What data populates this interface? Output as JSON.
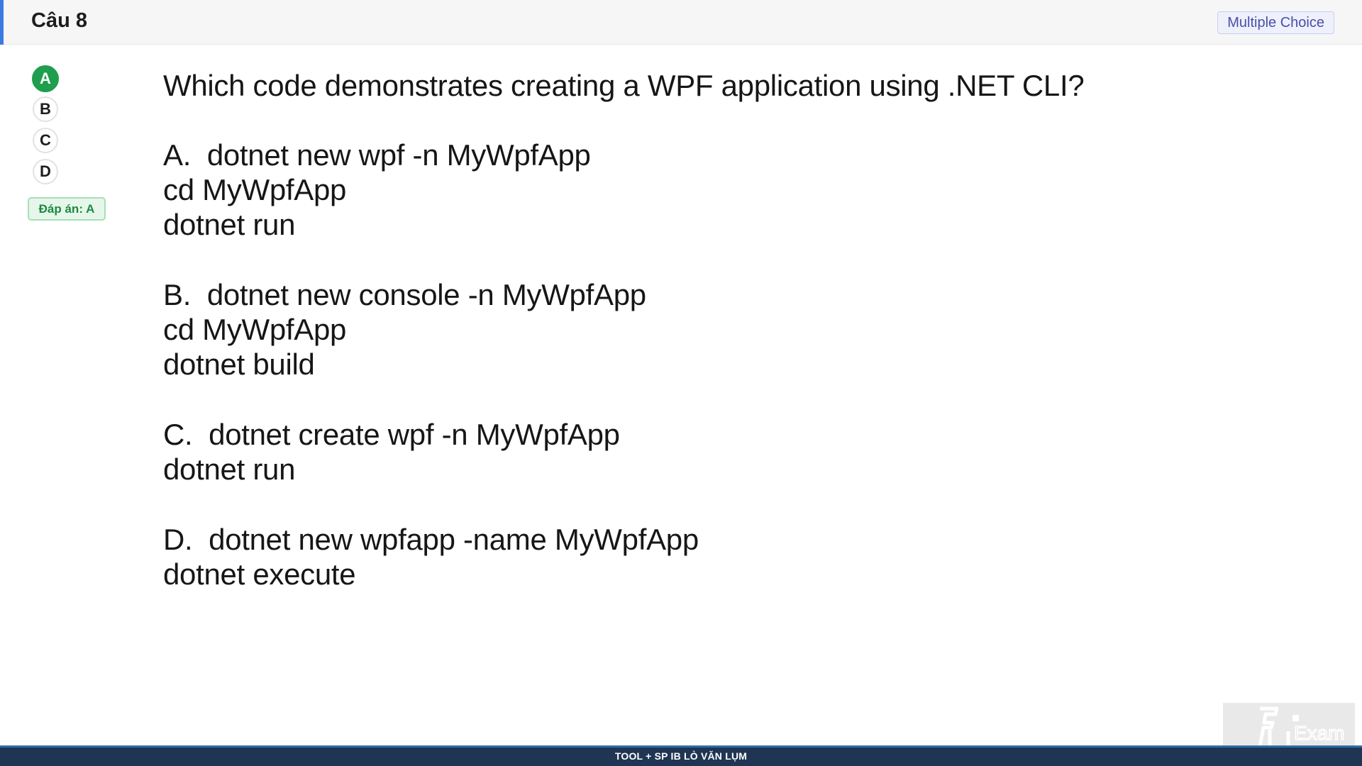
{
  "header": {
    "question_number": "Câu 8",
    "question_type": "Multiple Choice"
  },
  "options": [
    {
      "letter": "A",
      "correct": true
    },
    {
      "letter": "B",
      "correct": false
    },
    {
      "letter": "C",
      "correct": false
    },
    {
      "letter": "D",
      "correct": false
    }
  ],
  "answer_label": "Đáp án: A",
  "question": {
    "text": "Which code demonstrates creating a WPF application using .NET CLI?",
    "choices": [
      {
        "lines": [
          "A.  dotnet new wpf -n MyWpfApp",
          "cd MyWpfApp",
          "dotnet run"
        ]
      },
      {
        "lines": [
          "B.  dotnet new console -n MyWpfApp",
          "cd MyWpfApp",
          "dotnet build"
        ]
      },
      {
        "lines": [
          "C.  dotnet create wpf -n MyWpfApp",
          "dotnet run"
        ]
      },
      {
        "lines": [
          "D.  dotnet new wpfapp -name MyWpfApp",
          "dotnet execute"
        ]
      }
    ]
  },
  "watermark": {
    "icon": "fu-exam-logo-icon",
    "text": "Exam"
  },
  "footer": {
    "text": "TOOL + SP IB LÒ VĂN LỤM"
  },
  "colors": {
    "accent": "#3b7be0",
    "correct": "#1f9e4d",
    "footer_bg": "#1f3553"
  }
}
